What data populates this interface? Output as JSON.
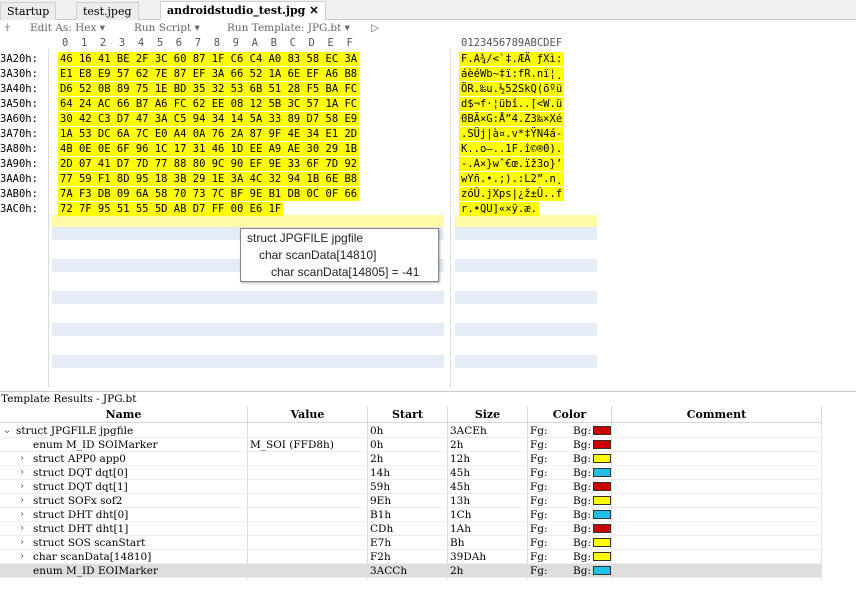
{
  "tabs": [
    {
      "label": "Startup"
    },
    {
      "label": "test.jpeg"
    },
    {
      "label": "androidstudio_test.jpg",
      "close": "✕"
    }
  ],
  "toolbar": {
    "edit_as": "Edit As: Hex ▾",
    "run_script": "Run Script ▾",
    "run_template": "Run Template: JPG.bt ▾",
    "play": "▷"
  },
  "hex": {
    "column_header": "0  1  2  3  4  5  6  7  8  9  A  B  C  D  E  F",
    "ascii_header": "0123456789ABCDEF",
    "rows": [
      {
        "addr": "3A20h:",
        "hex": "46 16 41 BE 2F 3C 60 87 1F C6 C4 A0 83 58 EC 3A",
        "ascii": "F.A¾/<`‡.ÆÄ ƒXì:"
      },
      {
        "addr": "3A30h:",
        "hex": "E1 E8 E9 57 62 7E 87 EF 3A 66 52 1A 6E EF A6 B8",
        "ascii": "áèéWb~‡ï:fR.nï¦¸"
      },
      {
        "addr": "3A40h:",
        "hex": "D6 52 0B 89 75 1E BD 35 32 53 6B 51 28 F5 BA FC",
        "ascii": "ÖR.‰u.½52SkQ(õºü"
      },
      {
        "addr": "3A50h:",
        "hex": "64 24 AC 66 B7 A6 FC 62 EE 08 12 5B 3C 57 1A FC",
        "ascii": "d$¬f·¦übî..[<W.ü"
      },
      {
        "addr": "3A60h:",
        "hex": "30 42 C3 D7 47 3A C5 94 34 14 5A 33 89 D7 58 E9",
        "ascii": "0BÃ×G:Å”4.Z3‰×Xé"
      },
      {
        "addr": "3A70h:",
        "hex": "1A 53 DC 6A 7C E0 A4 0A 76 2A 87 9F 4E 34 E1 2D",
        "ascii": ".SÜj|à¤.v*‡ŸN4á-"
      },
      {
        "addr": "3A80h:",
        "hex": "4B 0E 0E 6F 96 1C 17 31 46 1D EE A9 AE 30 29 1B",
        "ascii": "K..o–..1F.î©®0)."
      },
      {
        "addr": "3A90h:",
        "hex": "2D 07 41 D7 7D 77 88 80 9C 90 EF 9E 33 6F 7D 92",
        "ascii": "-.A×}wˆ€œ.ïž3o}’"
      },
      {
        "addr": "3AA0h:",
        "hex": "77 59 F1 8D 95 18 3B 29 1E 3A 4C 32 94 1B 6E B8",
        "ascii": "wYñ.•.;).:L2”.n¸"
      },
      {
        "addr": "3AB0h:",
        "hex": "7A F3 DB 09 6A 58 70 73 7C BF 9E B1 DB 0C 0F 66",
        "ascii": "zóÛ.jXps|¿ž±Û..f"
      },
      {
        "addr": "3AC0h:",
        "hex": "72 7F 95 51 55 5D AB D7 FF 00 E6 1F",
        "ascii": "r.•QU]«×ÿ.æ."
      }
    ]
  },
  "tooltip": {
    "line1": "struct JPGFILE jpgfile",
    "line2": "char scanData[14810]",
    "line3": "char scanData[14805] = -41"
  },
  "results": {
    "title": "Template Results - JPG.bt",
    "headers": {
      "name": "Name",
      "value": "Value",
      "start": "Start",
      "size": "Size",
      "color": "Color",
      "comment": "Comment"
    },
    "fg_label": "Fg:",
    "bg_label": "Bg:",
    "rows": [
      {
        "name": "struct JPGFILE jpgfile",
        "value": "",
        "start": "0h",
        "size": "3ACEh",
        "bg": "#cc0000",
        "arrow": "⌄"
      },
      {
        "name": "enum M_ID SOIMarker",
        "value": "M_SOI (FFD8h)",
        "start": "0h",
        "size": "2h",
        "bg": "#cc0000",
        "arrow": ""
      },
      {
        "name": "struct APP0 app0",
        "value": "",
        "start": "2h",
        "size": "12h",
        "bg": "#ffff00",
        "arrow": "›"
      },
      {
        "name": "struct DQT dqt[0]",
        "value": "",
        "start": "14h",
        "size": "45h",
        "bg": "#20c0e8",
        "arrow": "›"
      },
      {
        "name": "struct DQT dqt[1]",
        "value": "",
        "start": "59h",
        "size": "45h",
        "bg": "#cc0000",
        "arrow": "›"
      },
      {
        "name": "struct SOFx sof2",
        "value": "",
        "start": "9Eh",
        "size": "13h",
        "bg": "#ffff00",
        "arrow": "›"
      },
      {
        "name": "struct DHT dht[0]",
        "value": "",
        "start": "B1h",
        "size": "1Ch",
        "bg": "#20c0e8",
        "arrow": "›"
      },
      {
        "name": "struct DHT dht[1]",
        "value": "",
        "start": "CDh",
        "size": "1Ah",
        "bg": "#cc0000",
        "arrow": "›"
      },
      {
        "name": "struct SOS scanStart",
        "value": "",
        "start": "E7h",
        "size": "Bh",
        "bg": "#ffff00",
        "arrow": "›"
      },
      {
        "name": "char scanData[14810]",
        "value": "",
        "start": "F2h",
        "size": "39DAh",
        "bg": "#ffff00",
        "arrow": "›"
      },
      {
        "name": "enum M_ID EOIMarker",
        "value": "",
        "start": "3ACCh",
        "size": "2h",
        "bg": "#20c0e8",
        "arrow": ""
      }
    ]
  },
  "colors": {
    "highlight": "#ffff00",
    "stripe": "#e6ecf6",
    "selected_row": "#dedede"
  }
}
